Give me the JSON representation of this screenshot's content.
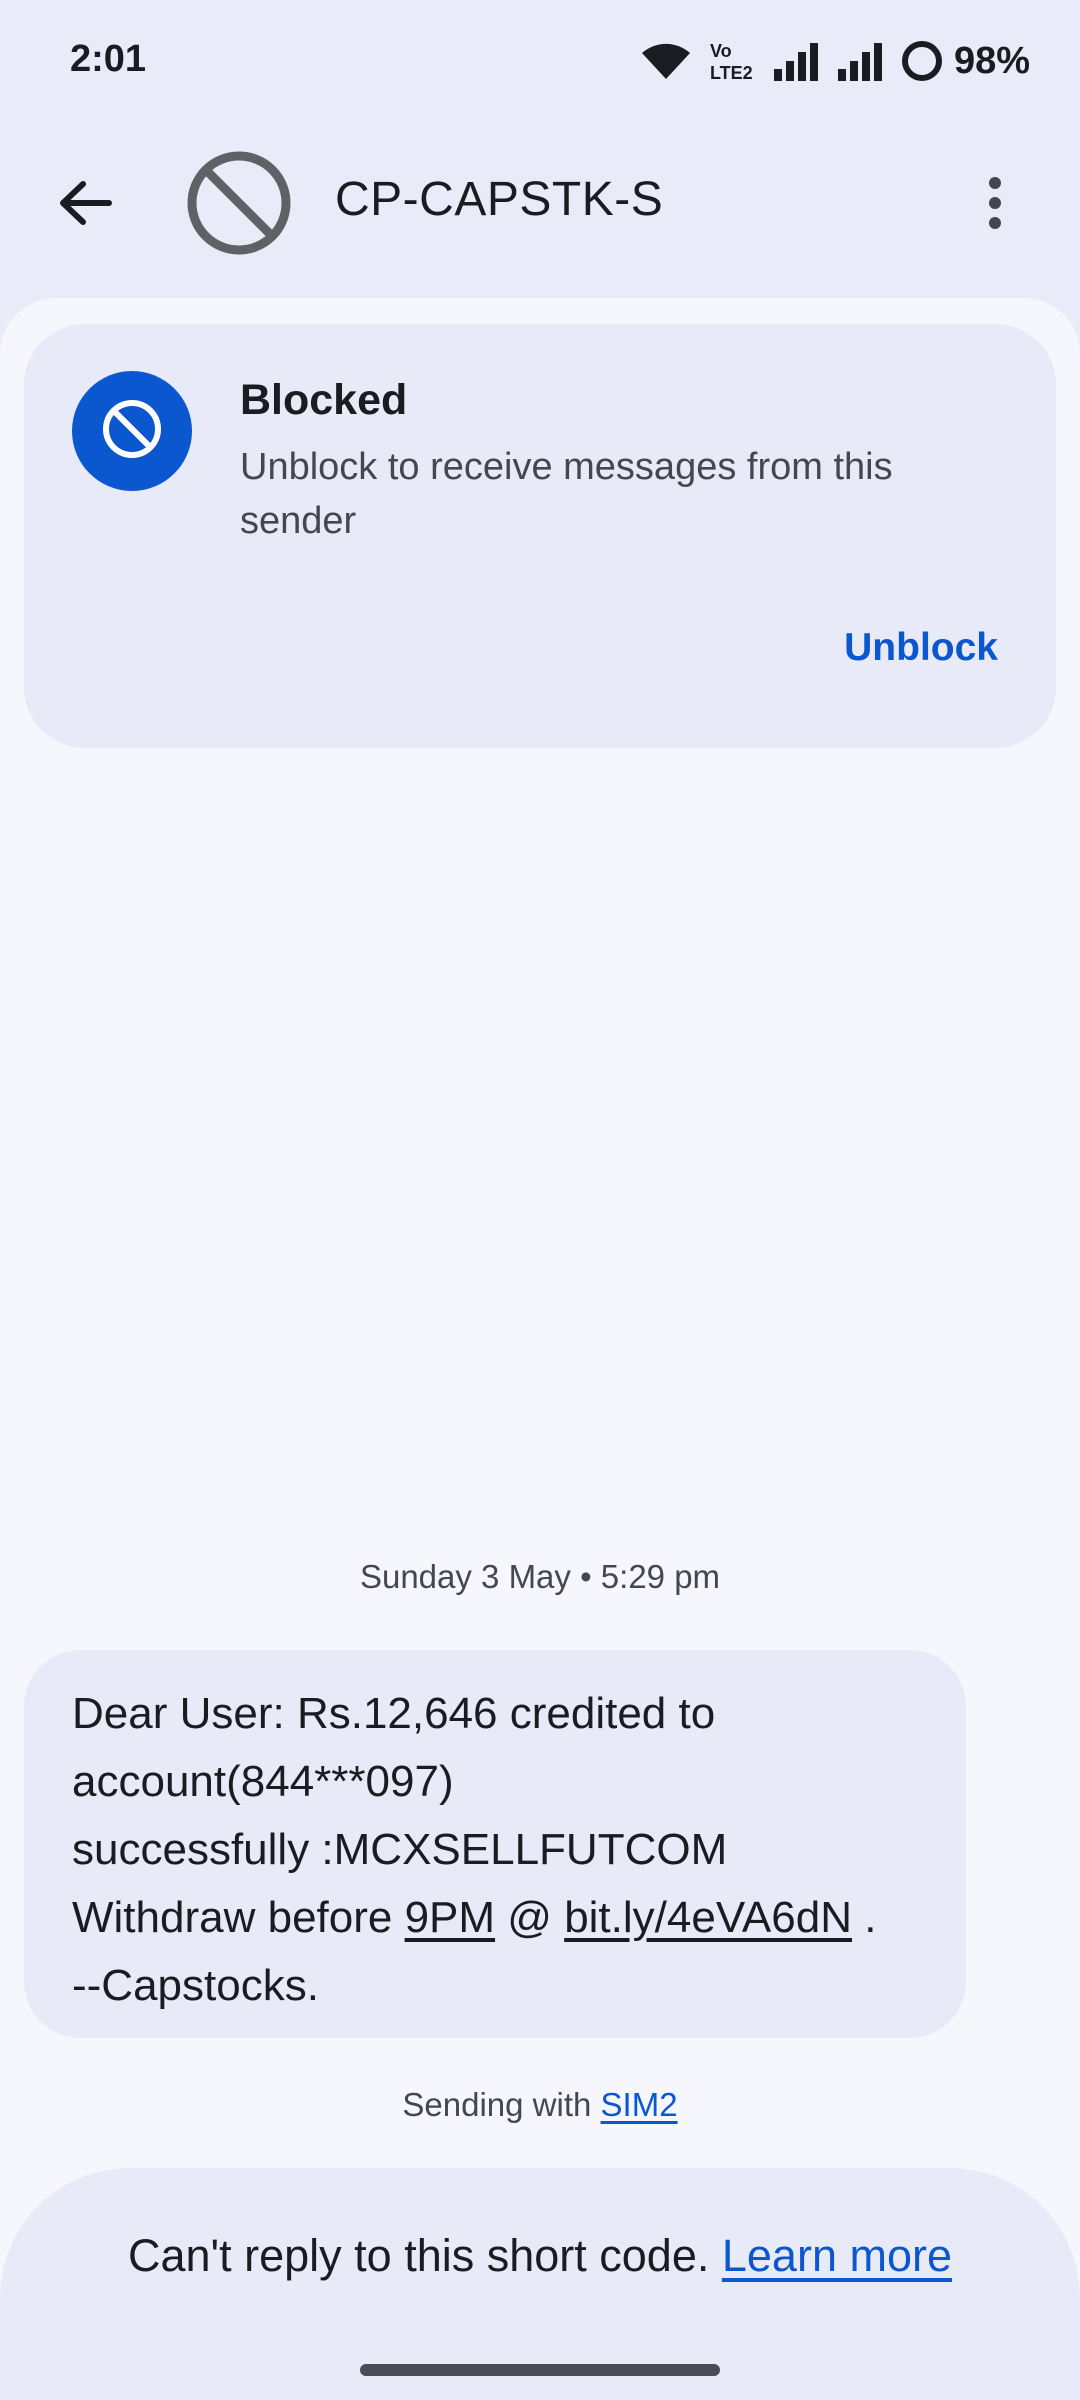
{
  "status_bar": {
    "time": "2:01",
    "network_label": "Vo LTE2",
    "battery": "98%",
    "icons": [
      "wifi-icon",
      "volte-icon",
      "signal-sim1-icon",
      "signal-sim2-icon",
      "battery-icon"
    ]
  },
  "header": {
    "contact_name": "CP-CAPSTK-S",
    "back_icon": "arrow-back-icon",
    "avatar_icon": "blocked-icon",
    "menu_icon": "more-vert-icon"
  },
  "blocked_card": {
    "title": "Blocked",
    "description": "Unblock to receive messages from this sender",
    "action_label": "Unblock"
  },
  "conversation": {
    "timestamp": "Sunday 3 May • 5:29 pm",
    "message": {
      "line1": "Dear User: Rs.12,646 credited to",
      "line2": "account(844***097)",
      "line3": "successfully :MCXSELLFUTCOM",
      "line4_prefix": "Withdraw before ",
      "time_link": "9PM",
      "at_sign": " @ ",
      "url_link": "bit.ly/4eVA6dN",
      "line4_suffix": " .",
      "line5": "--Capstocks."
    },
    "sim_prefix": "Sending with ",
    "sim_link": "SIM2"
  },
  "footer": {
    "notice": "Can't reply to this short code.",
    "learn_more": "Learn more"
  },
  "colors": {
    "accent": "#0b57d0",
    "background": "#e9ecf8",
    "sheet": "#f5f7fd",
    "card": "#e8ebf7"
  }
}
